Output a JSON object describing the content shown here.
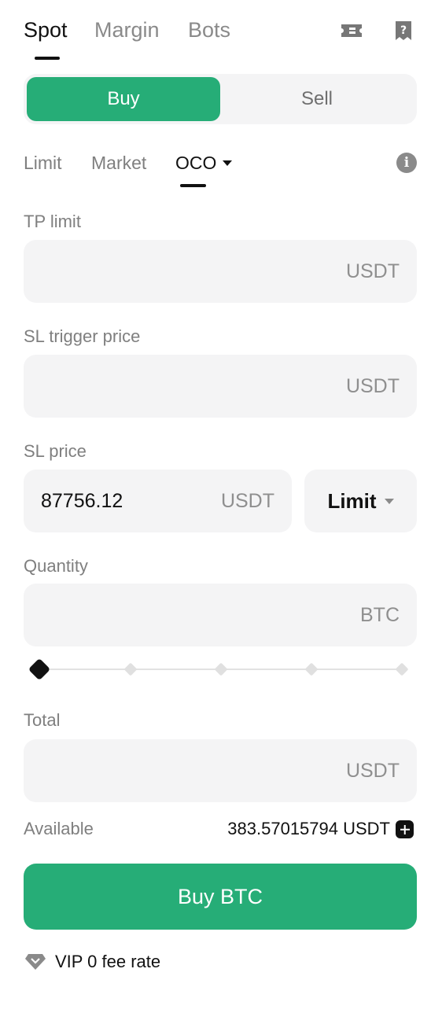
{
  "top_tabs": [
    {
      "label": "Spot",
      "active": true
    },
    {
      "label": "Margin",
      "active": false
    },
    {
      "label": "Bots",
      "active": false
    }
  ],
  "top_icons": [
    "ticket-icon",
    "help-document-icon"
  ],
  "side": {
    "buy_label": "Buy",
    "sell_label": "Sell",
    "selected": "Buy"
  },
  "order_types": [
    {
      "label": "Limit",
      "active": false
    },
    {
      "label": "Market",
      "active": false
    },
    {
      "label": "OCO",
      "active": true,
      "has_dropdown": true
    }
  ],
  "fields": {
    "tp_limit": {
      "label": "TP limit",
      "value": "",
      "unit": "USDT"
    },
    "sl_trigger_price": {
      "label": "SL trigger price",
      "value": "",
      "unit": "USDT"
    },
    "sl_price": {
      "label": "SL price",
      "value": "87756.12",
      "unit": "USDT",
      "type_selector": "Limit"
    },
    "quantity": {
      "label": "Quantity",
      "value": "",
      "unit": "BTC"
    },
    "total": {
      "label": "Total",
      "value": "",
      "unit": "USDT"
    }
  },
  "quantity_slider": {
    "value_percent": 0,
    "stops": [
      0,
      25,
      50,
      75,
      100
    ]
  },
  "available": {
    "label": "Available",
    "value": "383.57015794 USDT"
  },
  "submit_label": "Buy BTC",
  "vip": {
    "text": "VIP 0 fee rate"
  },
  "colors": {
    "accent_green": "#26ad77",
    "field_bg": "#f4f4f5",
    "muted_text": "#7f7f7f"
  }
}
